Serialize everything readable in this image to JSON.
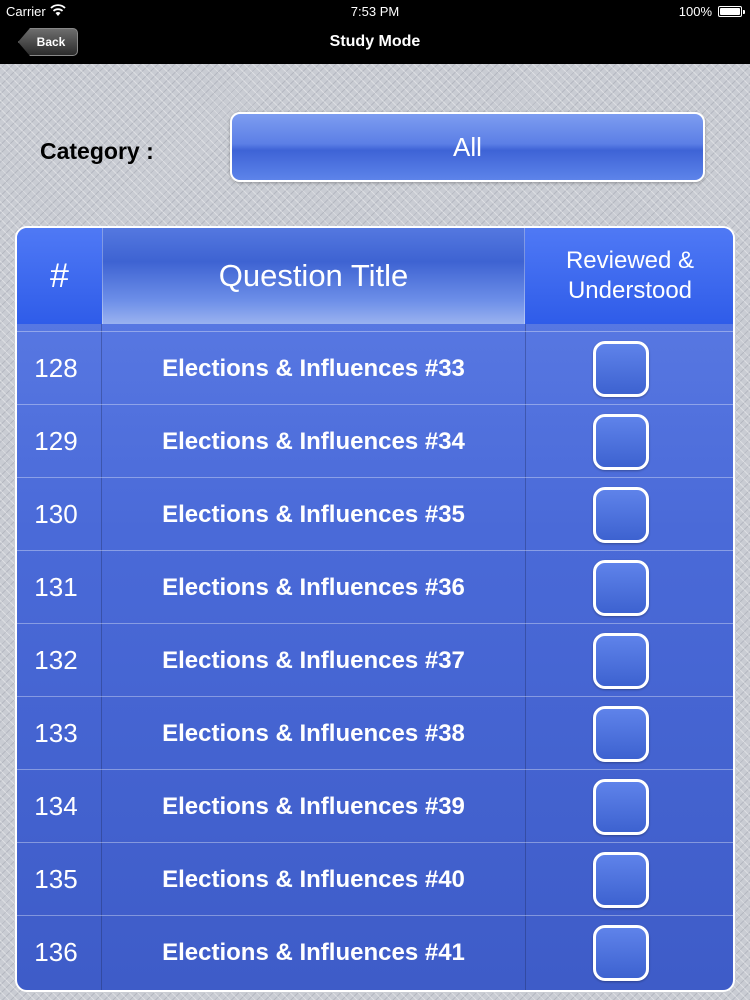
{
  "status_bar": {
    "carrier": "Carrier",
    "time": "7:53 PM",
    "battery": "100%",
    "wifi_icon": "wifi-icon",
    "battery_icon": "battery-icon"
  },
  "nav": {
    "title": "Study Mode",
    "back_label": "Back"
  },
  "category": {
    "label": "Category :",
    "value": "All"
  },
  "table": {
    "headers": {
      "number": "#",
      "title": "Question Title",
      "reviewed": "Reviewed & Understood"
    },
    "rows": [
      {
        "number": "128",
        "title": "Elections & Influences #33",
        "reviewed": false
      },
      {
        "number": "129",
        "title": "Elections & Influences #34",
        "reviewed": false
      },
      {
        "number": "130",
        "title": "Elections & Influences #35",
        "reviewed": false
      },
      {
        "number": "131",
        "title": "Elections & Influences #36",
        "reviewed": false
      },
      {
        "number": "132",
        "title": "Elections & Influences #37",
        "reviewed": false
      },
      {
        "number": "133",
        "title": "Elections & Influences #38",
        "reviewed": false
      },
      {
        "number": "134",
        "title": "Elections & Influences #39",
        "reviewed": false
      },
      {
        "number": "135",
        "title": "Elections & Influences #40",
        "reviewed": false
      },
      {
        "number": "136",
        "title": "Elections & Influences #41",
        "reviewed": false
      }
    ]
  },
  "colors": {
    "accent": "#3e63d6",
    "header_blue": "#2f5ce9",
    "nav_background": "#000000"
  }
}
